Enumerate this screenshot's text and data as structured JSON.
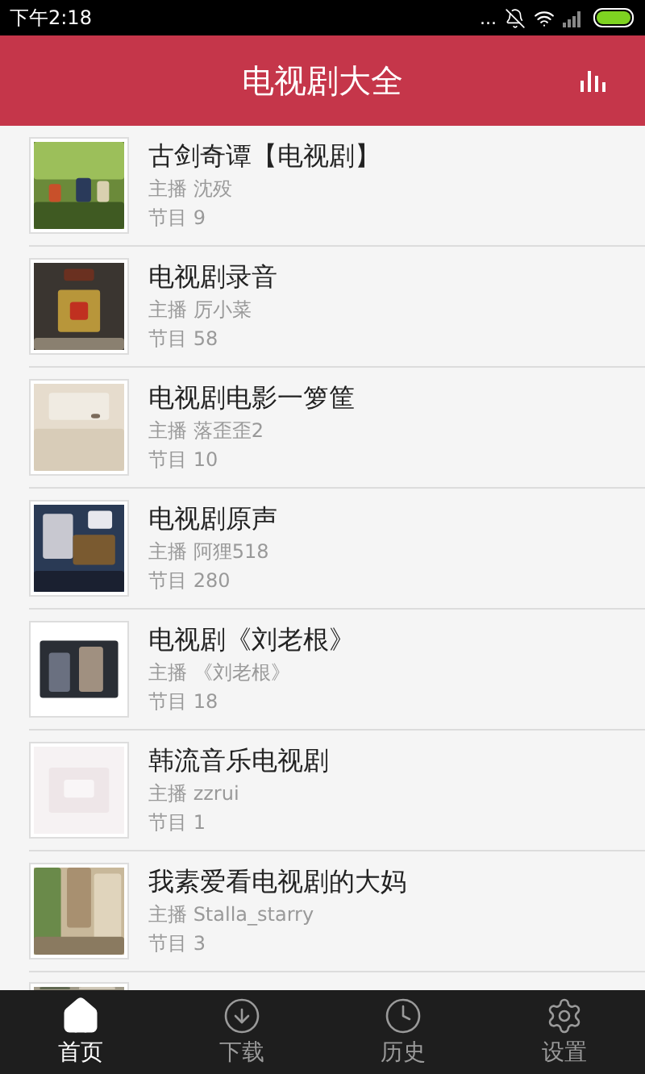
{
  "status_bar": {
    "time": "下午2:18",
    "dots": "..."
  },
  "header": {
    "title": "电视剧大全"
  },
  "programs": [
    {
      "title": "古剑奇谭【电视剧】",
      "host": "主播 沈殁",
      "episodes": "节目 9"
    },
    {
      "title": "电视剧录音",
      "host": "主播 厉小菜",
      "episodes": "节目 58"
    },
    {
      "title": "电视剧电影一箩筐",
      "host": "主播 落歪歪2",
      "episodes": "节目 10"
    },
    {
      "title": "电视剧原声",
      "host": "主播 阿狸518",
      "episodes": "节目 280"
    },
    {
      "title": "电视剧《刘老根》",
      "host": "主播 《刘老根》",
      "episodes": "节目 18"
    },
    {
      "title": "韩流音乐电视剧",
      "host": "主播 zzrui",
      "episodes": "节目 1"
    },
    {
      "title": "我素爱看电视剧的大妈",
      "host": "主播 Stalla_starry",
      "episodes": "节目 3"
    }
  ],
  "tab_bar": [
    {
      "label": "首页",
      "selected": true
    },
    {
      "label": "下载",
      "selected": false
    },
    {
      "label": "历史",
      "selected": false
    },
    {
      "label": "设置",
      "selected": false
    }
  ]
}
